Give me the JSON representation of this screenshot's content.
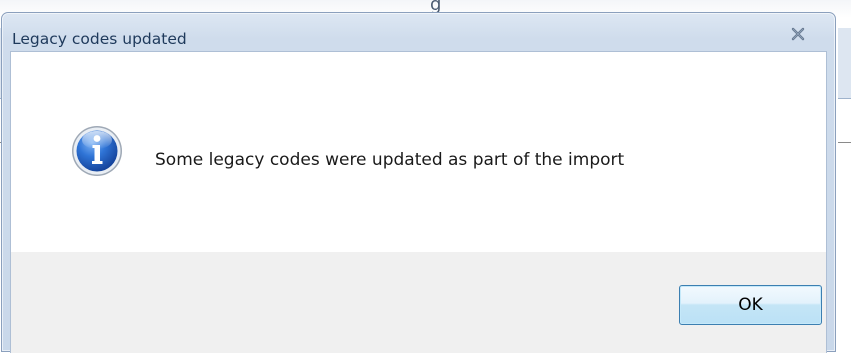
{
  "background": {
    "title_fragment": "g"
  },
  "dialog": {
    "title": "Legacy codes updated",
    "close_glyph": "x",
    "icon": "information-icon",
    "message": "Some legacy codes were updated as part of the import",
    "ok_label": "OK"
  },
  "colors": {
    "title_text": "#1e395b",
    "frame": "#c9d8ea",
    "button_border": "#3c7fb1",
    "icon_blue": "#1c5bbf"
  }
}
